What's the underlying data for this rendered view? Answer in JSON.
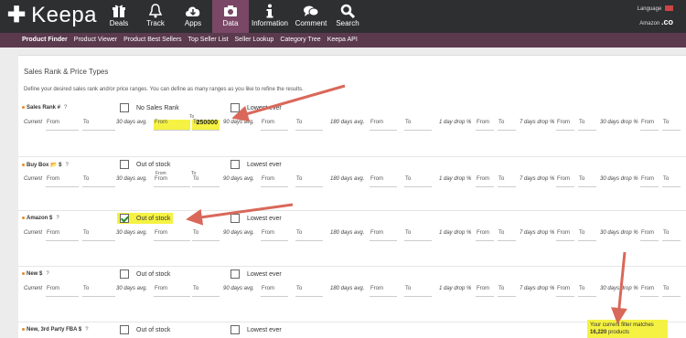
{
  "brand": {
    "name": "Keepa",
    "accent": "#7a4766",
    "bar": "#2e2f31",
    "subbar": "#5b3a4e"
  },
  "nav": [
    {
      "label": "Deals",
      "icon": "gift-icon",
      "active": false
    },
    {
      "label": "Track",
      "icon": "bell-icon",
      "active": false
    },
    {
      "label": "Apps",
      "icon": "cloud-icon",
      "active": false
    },
    {
      "label": "Data",
      "icon": "camera-icon",
      "active": true
    },
    {
      "label": "Information",
      "icon": "info-icon",
      "active": false
    },
    {
      "label": "Comment",
      "icon": "comment-icon",
      "active": false
    },
    {
      "label": "Search",
      "icon": "search-icon",
      "active": false
    }
  ],
  "locale": {
    "language_label": "Language",
    "amazon_label": "Amazon",
    "domain": ".co"
  },
  "subnav": [
    "Product Finder",
    "Product Viewer",
    "Product Best Sellers",
    "Top Seller List",
    "Seller Lookup",
    "Category Tree",
    "Keepa API"
  ],
  "panel": {
    "title": "Sales Rank & Price Types",
    "description": "Define your desired sales rank and/or price ranges. You can define as many ranges as you like to refine the results."
  },
  "labels": {
    "current": "Current",
    "from": "From",
    "to": "To",
    "avg30": "30 days avg.",
    "avg90": "90 days avg.",
    "avg180": "180 days avg.",
    "drop1": "1 day drop %",
    "drop7": "7 days drop %",
    "drop30": "30 days drop %",
    "lowest_ever": "Lowest ever",
    "q": "?"
  },
  "sections": [
    {
      "name": "Sales Rank #",
      "option": "No Sales Rank",
      "option_checked": false,
      "avg30_to_value": "250000"
    },
    {
      "name": "Buy Box 📂 $",
      "option": "Out of stock",
      "option_checked": false
    },
    {
      "name": "Amazon $",
      "option": "Out of stock",
      "option_checked": true
    },
    {
      "name": "New $",
      "option": "Out of stock",
      "option_checked": false
    },
    {
      "name": "New, 3rd Party FBA $",
      "option": "Out of stock",
      "option_checked": false
    }
  ],
  "filter_result": {
    "prefix": "Your current filter matches",
    "count": "16,220",
    "suffix": "products"
  },
  "annotation_color": "#d9685a"
}
